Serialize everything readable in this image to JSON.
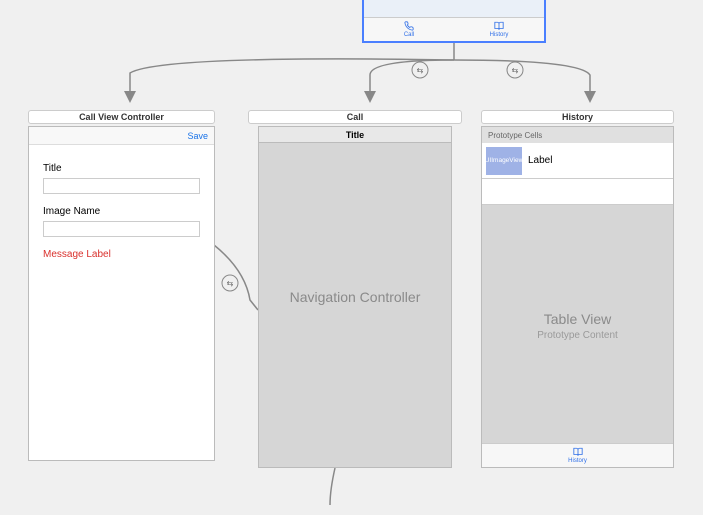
{
  "root_tabbar": {
    "call": {
      "label": "Call"
    },
    "history": {
      "label": "History"
    }
  },
  "scenes": {
    "detail": {
      "title": "Call View Controller",
      "save": "Save",
      "field1": "Title",
      "field2": "Image Name",
      "message": "Message Label"
    },
    "call": {
      "title": "Call",
      "nav_title": "Title",
      "body": "Navigation Controller"
    },
    "history": {
      "title": "History",
      "proto_header": "Prototype Cells",
      "cell_image": "UIImageView",
      "cell_label": "Label",
      "table_view": "Table View",
      "proto_content": "Prototype Content",
      "tab_label": "History"
    }
  }
}
